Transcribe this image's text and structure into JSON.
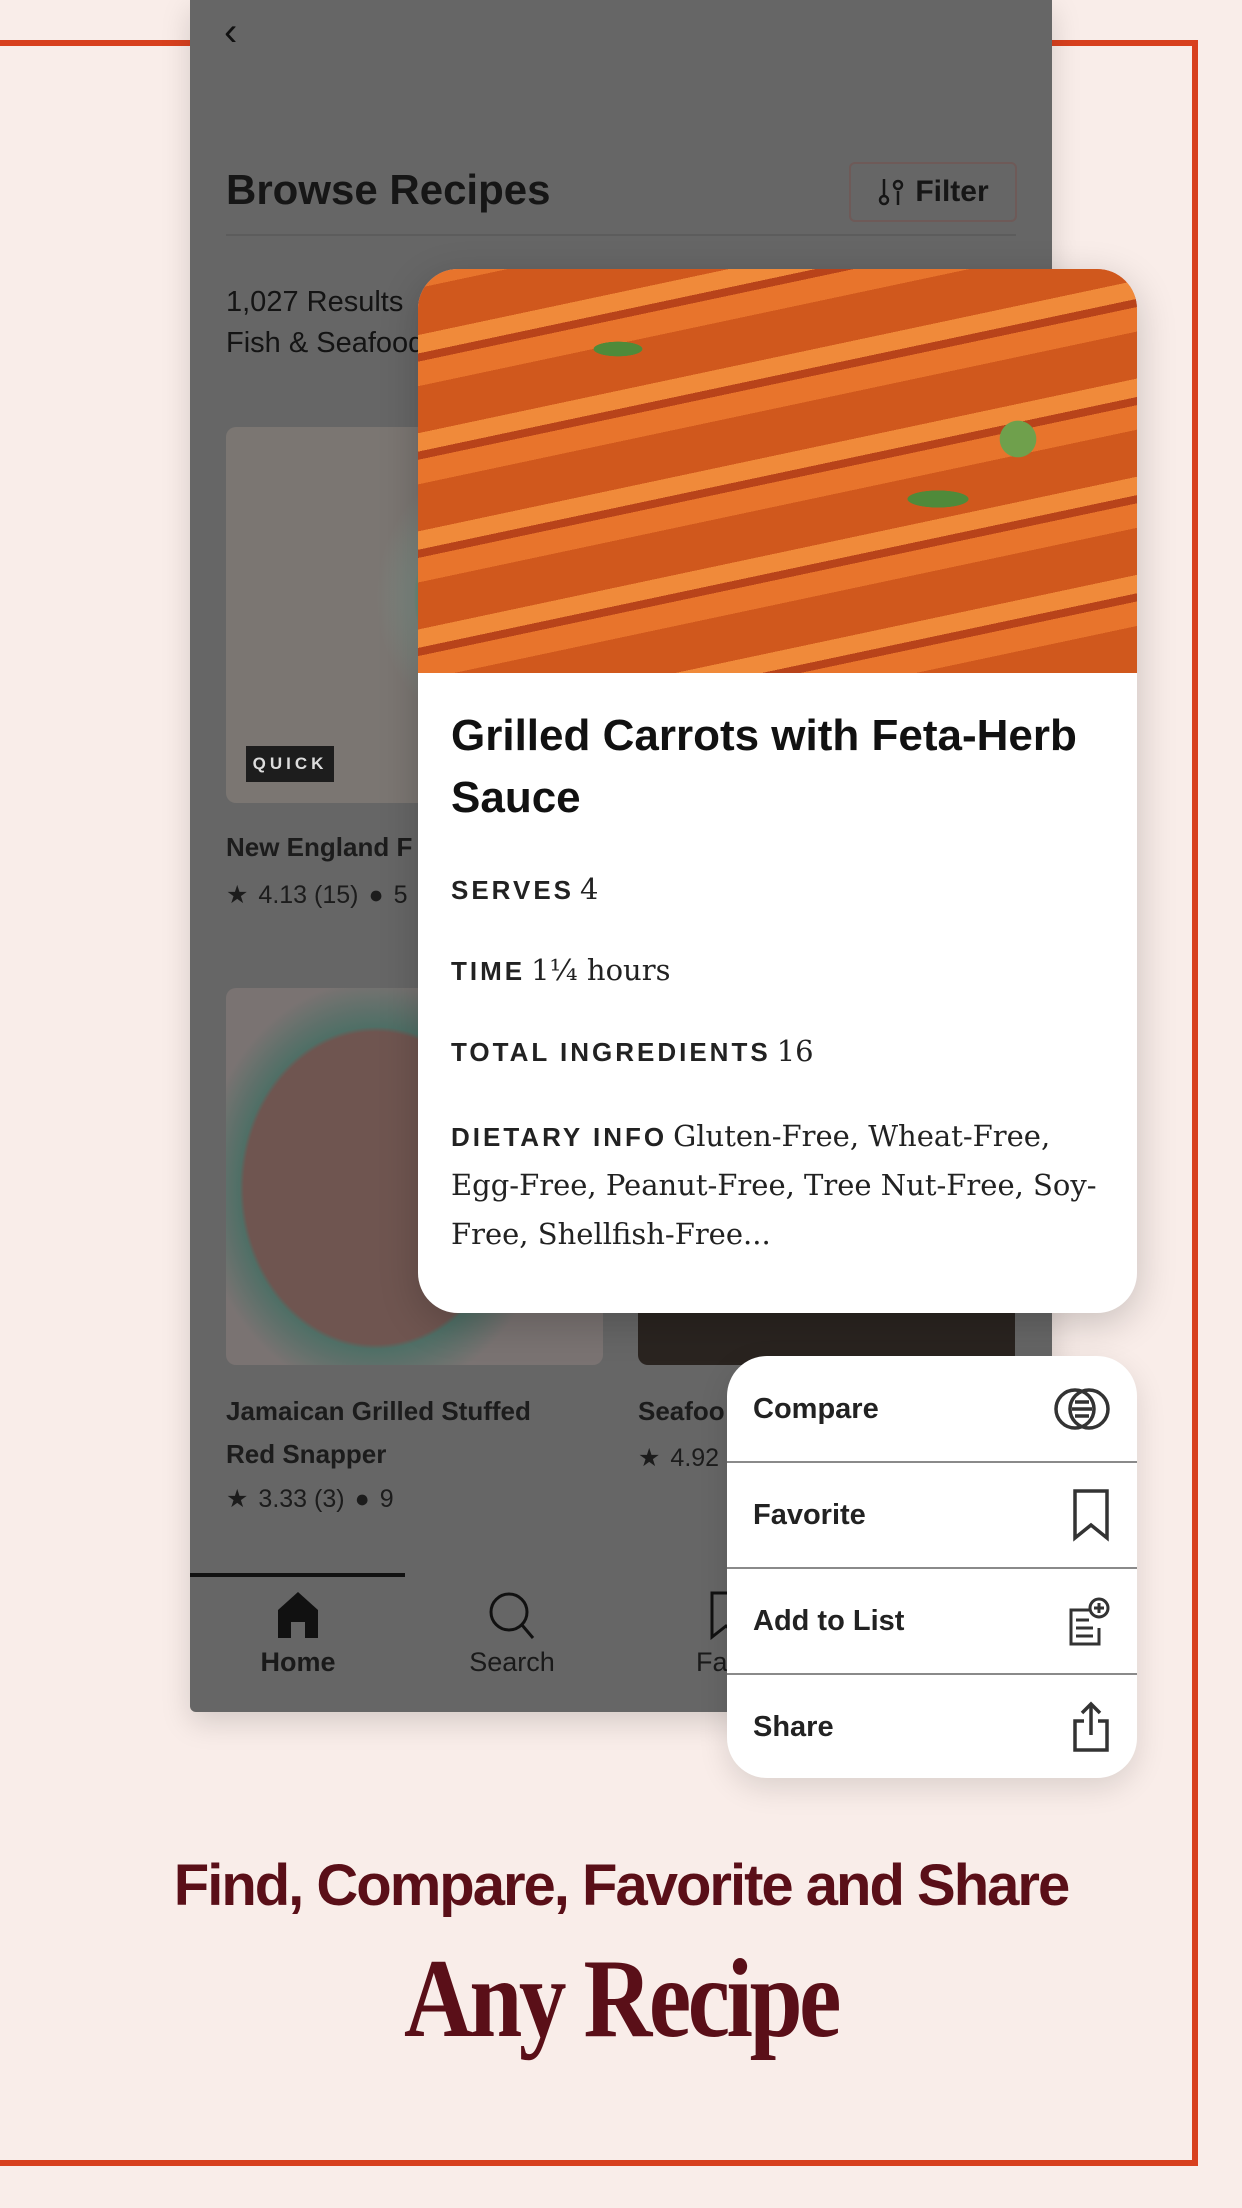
{
  "colors": {
    "frame": "#d8401e",
    "brand": "#5a0f18",
    "overlay": "#666666"
  },
  "header": {
    "back_icon": "chevron-left-icon",
    "title": "Browse Recipes",
    "filter_label": "Filter",
    "filter_icon": "sliders-icon"
  },
  "results": {
    "count": "1,027 Results",
    "category": "Fish & Seafood"
  },
  "recipes": [
    {
      "title": "New England F",
      "badge": "QUICK",
      "rating": "4.13 (15)",
      "comments": "5"
    },
    {
      "title_line1": "Jamaican Grilled Stuffed",
      "title_line2": "Red Snapper",
      "rating": "3.33 (3)",
      "comments": "9"
    },
    {
      "title": "Seafoo",
      "rating": "4.92"
    }
  ],
  "nav": {
    "items": [
      {
        "label": "Home",
        "icon": "home-icon"
      },
      {
        "label": "Search",
        "icon": "search-icon"
      },
      {
        "label": "Favo",
        "icon": "bookmark-icon"
      }
    ]
  },
  "popup": {
    "title": "Grilled Carrots with Feta-Herb Sauce",
    "serves_label": "SERVES",
    "serves": "4",
    "time_label": "TIME",
    "time": "1¼ hours",
    "ingredients_label": "TOTAL INGREDIENTS",
    "ingredients": "16",
    "dietary_label": "DIETARY INFO",
    "dietary": "Gluten-Free, Wheat-Free, Egg-Free, Peanut-Free, Tree Nut-Free, Soy-Free, Shellfish-Free..."
  },
  "menu": [
    {
      "label": "Compare",
      "icon": "compare-icon"
    },
    {
      "label": "Favorite",
      "icon": "bookmark-icon"
    },
    {
      "label": "Add to List",
      "icon": "add-to-list-icon"
    },
    {
      "label": "Share",
      "icon": "share-icon"
    }
  ],
  "tagline": {
    "line1": "Find, Compare, Favorite and Share",
    "line2": "Any Recipe"
  }
}
